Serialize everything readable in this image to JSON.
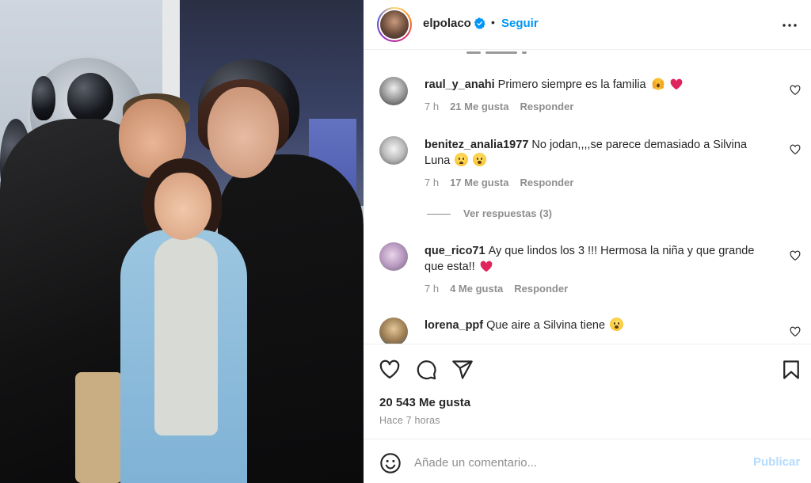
{
  "post": {
    "username": "elpolaco",
    "separator": "•",
    "follow_label": "Seguir",
    "verified": true
  },
  "comments": [
    {
      "username": "raul_y_anahi",
      "text": "Primero siempre es la familia",
      "emojis": [
        "hands-emoji",
        "red-heart-emoji"
      ],
      "time": "7 h",
      "likes": "21 Me gusta",
      "reply": "Responder"
    },
    {
      "username": "benitez_analia1977",
      "text": "No jodan,,,,se parece demasiado a Silvina Luna",
      "emojis": [
        "sad-face-emoji",
        "surprised-face-emoji"
      ],
      "time": "7 h",
      "likes": "17 Me gusta",
      "reply": "Responder",
      "view_replies": "Ver respuestas (3)"
    },
    {
      "username": "que_rico71",
      "text": "Ay que lindos los 3 !!! Hermosa la niña y que grande que esta!!",
      "emojis": [
        "red-heart-emoji"
      ],
      "time": "7 h",
      "likes": "4 Me gusta",
      "reply": "Responder"
    },
    {
      "username": "lorena_ppf",
      "text": "Que aire a Silvina tiene",
      "emojis": [
        "surprised-face-emoji"
      ]
    }
  ],
  "actions": {
    "like_icon": "heart-icon",
    "comment_icon": "comment-icon",
    "share_icon": "send-icon",
    "save_icon": "bookmark-icon"
  },
  "stats": {
    "likes": "20 543 Me gusta",
    "time_ago": "Hace 7 horas"
  },
  "add_comment": {
    "placeholder": "Añade un comentario...",
    "publish_label": "Publicar"
  },
  "colors": {
    "accent": "#0095f6",
    "publish_disabled": "#b3dbff",
    "secondary_text": "#8e8e8e",
    "heart_red": "#e0245e"
  }
}
